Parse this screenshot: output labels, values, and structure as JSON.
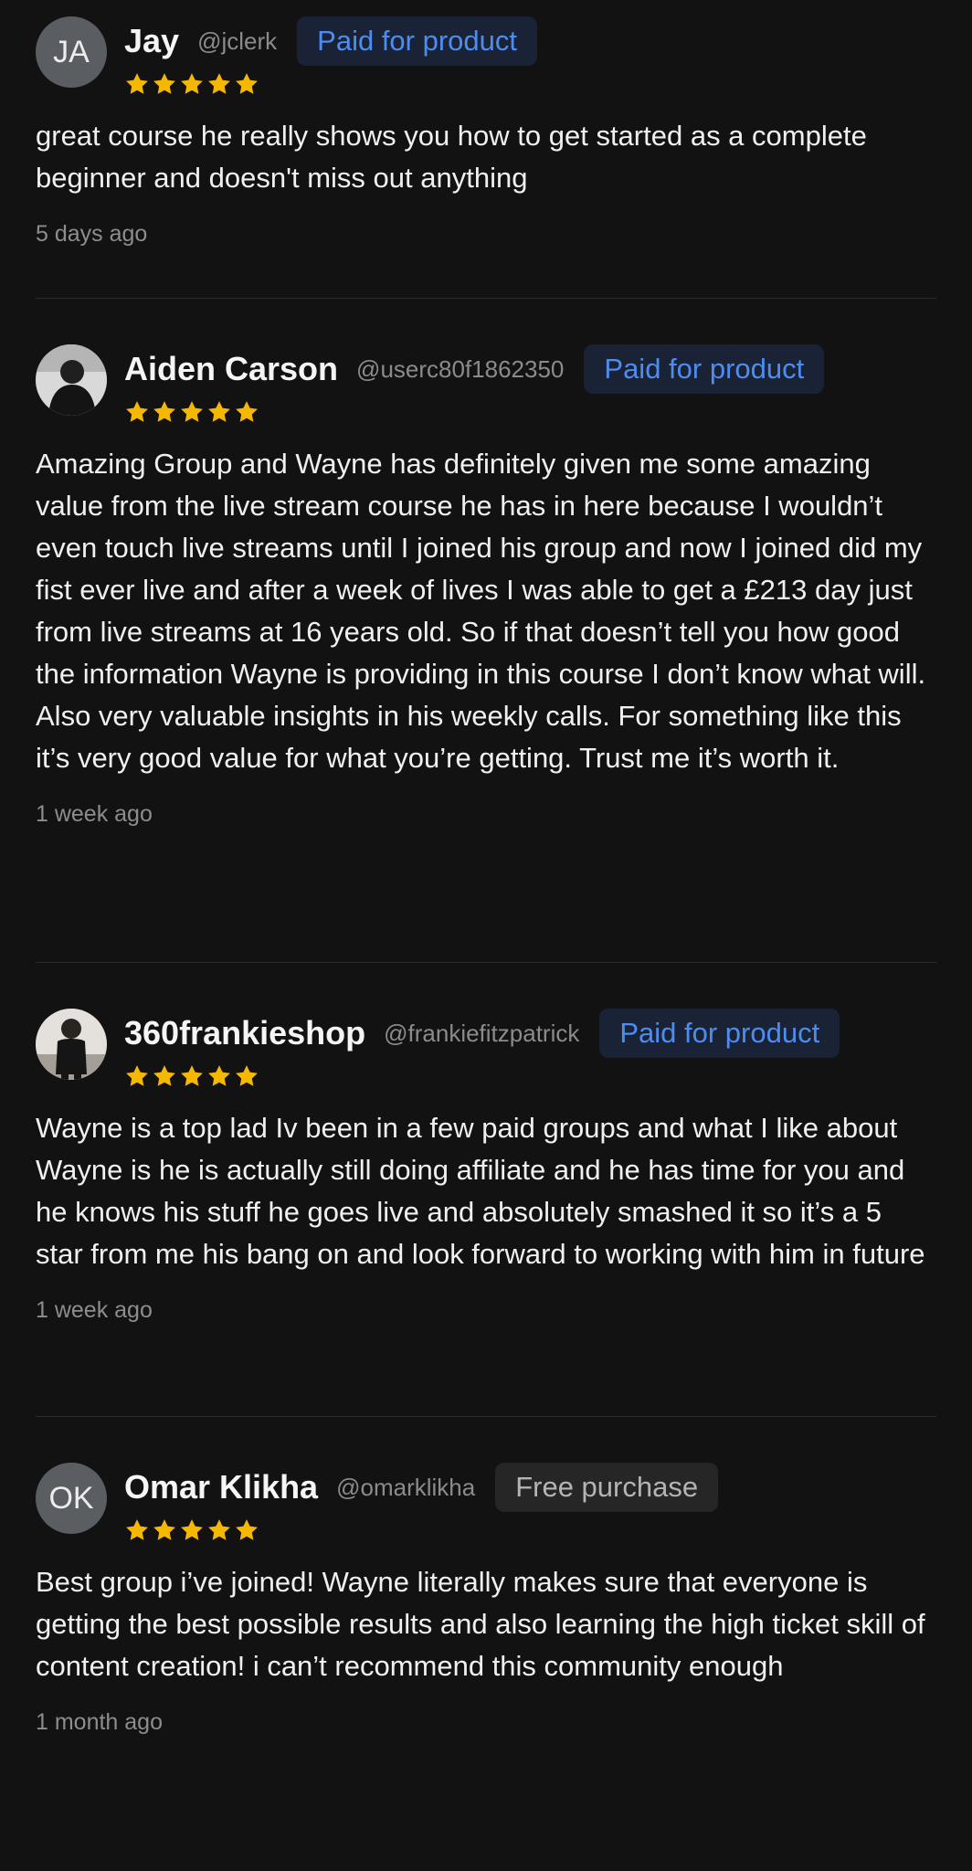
{
  "reviews": [
    {
      "avatar_initials": "JA",
      "avatar_type": "initials",
      "name": "Jay",
      "handle": "@jclerk",
      "badge": "Paid for product",
      "badge_type": "paid",
      "rating": 5,
      "body": "great course he really shows you how to get started as a complete beginner and doesn't miss out anything",
      "time": "5 days ago"
    },
    {
      "avatar_initials": "",
      "avatar_type": "photo",
      "name": "Aiden Carson",
      "handle": "@userc80f1862350",
      "badge": "Paid for product",
      "badge_type": "paid",
      "rating": 5,
      "body": "Amazing Group and Wayne has definitely given me some amazing value from the live stream course he has in here because I wouldn’t even touch live streams until I joined his group and now I joined did my fist ever live and after a week of lives I was able to get a £213 day just from live streams at 16 years old. So if that doesn’t tell you how good the information Wayne is providing in this course I don’t know what will. Also very valuable insights in his weekly calls. For something like this it’s very good value for what you’re getting. Trust me it’s worth it.",
      "time": "1 week ago"
    },
    {
      "avatar_initials": "",
      "avatar_type": "photo",
      "name": "360frankieshop",
      "handle": "@frankiefitzpatrick",
      "badge": "Paid for product",
      "badge_type": "paid",
      "rating": 5,
      "body": "Wayne is a top lad Iv been in a few paid groups and what I like about Wayne is he is actually still doing affiliate and he has time for you and he knows his stuff he goes live and absolutely smashed it so it’s a 5 star from me his bang on and look forward to working with him in future",
      "time": "1 week ago"
    },
    {
      "avatar_initials": "OK",
      "avatar_type": "initials",
      "name": "Omar Klikha",
      "handle": "@omarklikha",
      "badge": "Free purchase",
      "badge_type": "free",
      "rating": 5,
      "body": "Best group i’ve joined! Wayne literally makes sure that everyone is getting the best possible results and also learning the high ticket skill of content creation! i can’t recommend this community enough",
      "time": "1 month ago"
    }
  ],
  "colors": {
    "background": "#121212",
    "star": "#f5b800",
    "paid_badge_text": "#4d8cf0",
    "paid_badge_bg": "#1a2336",
    "free_badge_text": "#b4b4b4",
    "free_badge_bg": "#262626",
    "muted_text": "#8d8d8d"
  },
  "icons": {
    "star": "star-icon",
    "avatar_photo": "profile-photo"
  }
}
